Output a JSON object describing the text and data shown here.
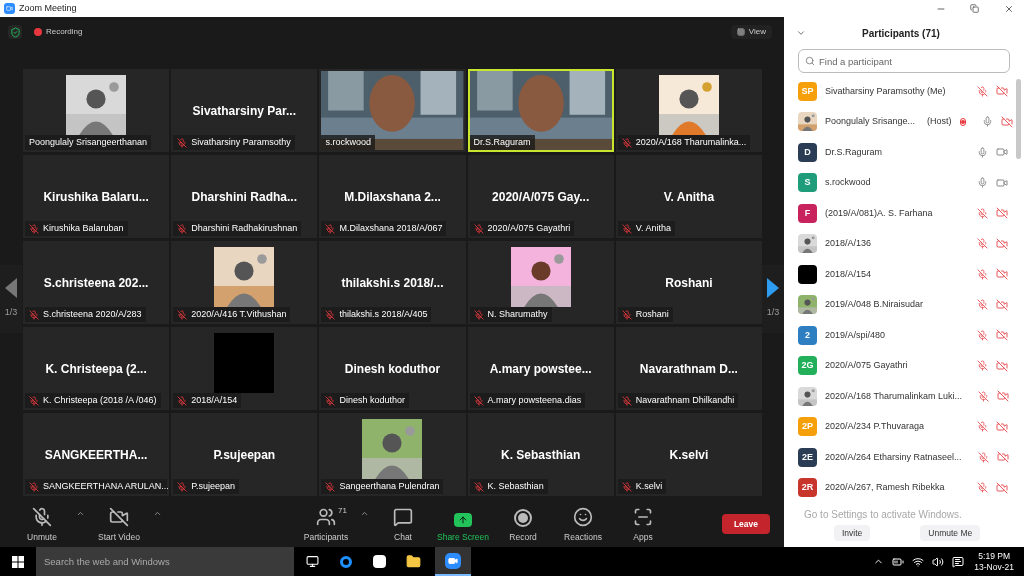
{
  "window": {
    "title": "Zoom Meeting"
  },
  "top_bar": {
    "recording": "Recording",
    "view": "View"
  },
  "pager": {
    "left": {
      "label": "1/3",
      "disabled": true
    },
    "right": {
      "label": "1/3",
      "disabled": false
    }
  },
  "tiles": [
    {
      "kind": "picture",
      "label": "Poongulaly Srisangeerthanan",
      "muted": false,
      "speaking": false
    },
    {
      "kind": "name",
      "name": "Sivatharsiny  Par...",
      "label": "Sivatharsiny Paramsothy",
      "muted": true,
      "speaking": false
    },
    {
      "kind": "video",
      "label": "s.rockwood",
      "muted": false,
      "speaking": false
    },
    {
      "kind": "video",
      "label": "Dr.S.Raguram",
      "muted": false,
      "speaking": true
    },
    {
      "kind": "picture",
      "label": "2020/A/168 Tharumalinka...",
      "muted": true,
      "speaking": false
    },
    {
      "kind": "name",
      "name": "Kirushika  Balaru...",
      "label": "Kirushika Balaruban",
      "muted": true,
      "speaking": false
    },
    {
      "kind": "name",
      "name": "Dharshini  Radha...",
      "label": "Dharshini Radhakirushnan",
      "muted": true,
      "speaking": false
    },
    {
      "kind": "name",
      "name": "M.Dilaxshana  2...",
      "label": "M.Dilaxshana 2018/A/067",
      "muted": true,
      "speaking": false
    },
    {
      "kind": "name",
      "name": "2020/A/075 Gay...",
      "label": "2020/A/075 Gayathri",
      "muted": true,
      "speaking": false
    },
    {
      "kind": "name",
      "name": "V. Anitha",
      "label": "V. Anitha",
      "muted": true,
      "speaking": false
    },
    {
      "kind": "name",
      "name": "S.christeena  202...",
      "label": "S.christeena 2020/A/283",
      "muted": true,
      "speaking": false
    },
    {
      "kind": "picture",
      "label": "2020/A/416 T.Vithushan",
      "muted": true,
      "speaking": false
    },
    {
      "kind": "name",
      "name": "thilakshi.s  2018/...",
      "label": "thilakshi.s 2018/A/405",
      "muted": true,
      "speaking": false
    },
    {
      "kind": "picture",
      "label": "N. Sharumathy",
      "muted": true,
      "speaking": false
    },
    {
      "kind": "name",
      "name": "Roshani",
      "label": "Roshani",
      "muted": true,
      "speaking": false
    },
    {
      "kind": "name",
      "name": "K. Christeepa  (2...",
      "label": "K. Christeepa (2018 /A /046)",
      "muted": true,
      "speaking": false
    },
    {
      "kind": "black",
      "label": "2018/A/154",
      "muted": true,
      "speaking": false
    },
    {
      "kind": "name",
      "name": "Dinesh  koduthor",
      "label": "Dinesh koduthor",
      "muted": true,
      "speaking": false
    },
    {
      "kind": "name",
      "name": "A.mary  powstee...",
      "label": "A.mary powsteena.dias",
      "muted": true,
      "speaking": false
    },
    {
      "kind": "name",
      "name": "Navarathnam  D...",
      "label": "Navarathnam Dhilkandhi",
      "muted": true,
      "speaking": false
    },
    {
      "kind": "name",
      "name": "SANGKEERTHA...",
      "label": "SANGKEERTHANA ARULAN...",
      "muted": true,
      "speaking": false
    },
    {
      "kind": "name",
      "name": "P.sujeepan",
      "label": "P.sujeepan",
      "muted": true,
      "speaking": false
    },
    {
      "kind": "picture",
      "label": "Sangeerthana Pulendran",
      "muted": true,
      "speaking": false
    },
    {
      "kind": "name",
      "name": "K. Sebasthian",
      "label": "K. Sebasthian",
      "muted": true,
      "speaking": false
    },
    {
      "kind": "name",
      "name": "K.selvi",
      "label": "K.selvi",
      "muted": true,
      "speaking": false
    }
  ],
  "toolbar": [
    {
      "kind": "mic",
      "label": "Unmute",
      "caret": true
    },
    {
      "kind": "video",
      "label": "Start Video",
      "caret": true
    },
    {
      "kind": "participants",
      "label": "Participants",
      "count": "71",
      "caret": true
    },
    {
      "kind": "chat",
      "label": "Chat",
      "caret": false
    },
    {
      "kind": "share",
      "label": "Share Screen",
      "caret": false
    },
    {
      "kind": "record",
      "label": "Record",
      "caret": false
    },
    {
      "kind": "reactions",
      "label": "Reactions",
      "caret": false
    },
    {
      "kind": "apps",
      "label": "Apps",
      "caret": false
    }
  ],
  "leave_button": "Leave",
  "participants_panel": {
    "title": "Participants (71)",
    "search_placeholder": "Find a participant",
    "participants": [
      {
        "avatar": {
          "kind": "initials",
          "text": "SP",
          "color": "#f59f0b"
        },
        "name": "Sivatharsiny Paramsothy (Me)",
        "mic_muted": true,
        "video_on": false
      },
      {
        "name": "Poongulaly Srisange...",
        "role": "(Host)",
        "recording": true,
        "mic_muted": false,
        "video_on": false
      },
      {
        "avatar": {
          "kind": "initials",
          "text": "D",
          "color": "#2b3d55"
        },
        "name": "Dr.S.Raguram",
        "mic_muted": false,
        "video_on": true
      },
      {
        "avatar": {
          "kind": "initials",
          "text": "S",
          "color": "#1f9d7a"
        },
        "name": "s.rockwood",
        "mic_muted": false,
        "video_on": true
      },
      {
        "avatar": {
          "kind": "initials",
          "text": "F",
          "color": "#c8235c"
        },
        "name": "(2019/A/081)A. S. Farhana",
        "mic_muted": true,
        "video_on": false
      },
      {
        "name": "2018/A/136",
        "mic_muted": true,
        "video_on": false
      },
      {
        "avatar": {
          "kind": "initials",
          "color": "#000000"
        },
        "name": "2018/A/154",
        "mic_muted": true,
        "video_on": false
      },
      {
        "name": "2019/A/048 B.Niraisudar",
        "mic_muted": true,
        "video_on": false
      },
      {
        "avatar": {
          "kind": "initials",
          "text": "2",
          "color": "#2d7fc1"
        },
        "name": "2019/A/spi/480",
        "mic_muted": true,
        "video_on": false
      },
      {
        "avatar": {
          "kind": "initials",
          "text": "2G",
          "color": "#22b05a"
        },
        "name": "2020/A/075 Gayathri",
        "mic_muted": true,
        "video_on": false
      },
      {
        "name": "2020/A/168 Tharumalinkam Luki...",
        "mic_muted": true,
        "video_on": false
      },
      {
        "avatar": {
          "kind": "initials",
          "text": "2P",
          "color": "#f59f0b"
        },
        "name": "2020/A/234 P.Thuvaraga",
        "mic_muted": true,
        "video_on": false
      },
      {
        "avatar": {
          "kind": "initials",
          "text": "2E",
          "color": "#2b3d55"
        },
        "name": "2020/A/264 Etharsiny Ratnaseel...",
        "mic_muted": true,
        "video_on": false
      },
      {
        "avatar": {
          "kind": "initials",
          "text": "2R",
          "color": "#c8352b"
        },
        "name": "2020/A/267, Ramesh Ribekka",
        "mic_muted": true,
        "video_on": false
      }
    ],
    "activation_notice": "Go to Settings to activate Windows.",
    "buttons": [
      "Invite",
      "Unmute Me"
    ]
  },
  "taskbar": {
    "search_placeholder": "Search the web and Windows",
    "time": "5:19 PM",
    "date": "13-Nov-21"
  }
}
